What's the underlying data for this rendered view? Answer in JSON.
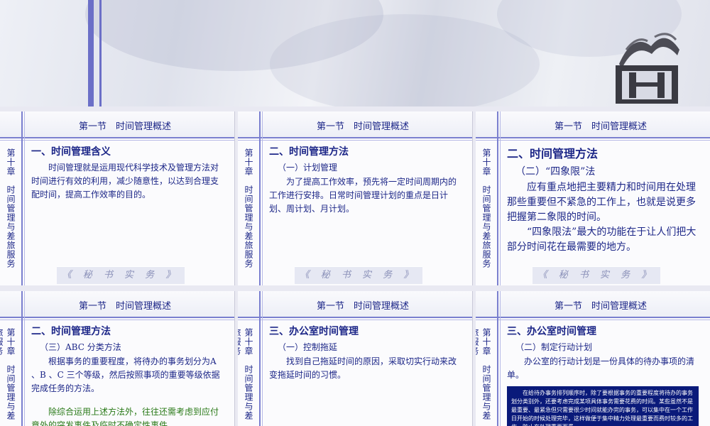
{
  "slides": [
    {
      "title": "第一节　时间管理概述",
      "side": "第十章　时间管理与差旅服务",
      "heading": "一、时间管理含义",
      "paragraph": "时间管理就是运用现代科学技术及管理方法对时间进行有效的利用，减少随意性，以达到合理支配时间，提高工作效率的目的。",
      "footer": "《 秘 书 实 务 》"
    },
    {
      "title": "第一节　时间管理概述",
      "side": "第十章　时间管理与差旅服务",
      "heading": "二、时间管理方法",
      "sub": "（一）计划管理",
      "paragraph": "为了提高工作效率，预先将一定时间周期内的工作进行安排。日常时间管理计划的重点是日计划、周计划、月计划。",
      "footer": "《 秘 书 实 务 》"
    },
    {
      "title": "第一节　时间管理概述",
      "side": "第十章　时间管理与差旅服务",
      "heading": "二、时间管理方法",
      "sub": "（二）“四象限”法",
      "paragraph": "应有重点地把主要精力和时间用在处理那些重要但不紧急的工作上，也就是说更多把握第二象限的时间。",
      "paragraph2": "“四象限法”最大的功能在于让人们把大部分时间花在最需要的地方。",
      "footer": "《 秘 书 实 务 》"
    },
    {
      "title": "第一节　时间管理概述",
      "side": "第十章　时间管理与差旅服务",
      "heading": "二、时间管理方法",
      "sub": "（三）ABC 分类方法",
      "paragraph": "根据事务的重要程度，将待办的事务划分为A 、B 、C 三个等级，然后按照事项的重要等级依据完成任务的方法。",
      "paragraph2": "除综合运用上述方法外，往往还需考虑到应付意外的突发事件及临时不确定性事件。"
    },
    {
      "title": "第一节　时间管理概述",
      "side": "第十章　时间管理与差旅服务",
      "heading": "三、办公室时间管理",
      "sub": "（一）控制拖延",
      "paragraph": "找到自己拖延时间的原因，采取切实行动来改变拖延时间的习惯。"
    },
    {
      "title": "第一节　时间管理概述",
      "side": "第十章　时间管理与差旅服务",
      "heading": "三、办公室时间管理",
      "sub": "（二）制定行动计划",
      "paragraph": "办公室的行动计划是一份具体的待办事项的清单。",
      "boxed": "在给待办事务排列顺序时，除了要根据事务的重要程度将待办的事务划分类别外，还要考虑完成某项具体事务需要花费的时间。某些虽然不是最重要、最紧急但只需要很少时间就能办完的事务，可以集中在一个工作日开始的时候处理完毕，这样做便于集中精力处理最重要而费时较多的工作，防止在处理重要而费"
    }
  ]
}
